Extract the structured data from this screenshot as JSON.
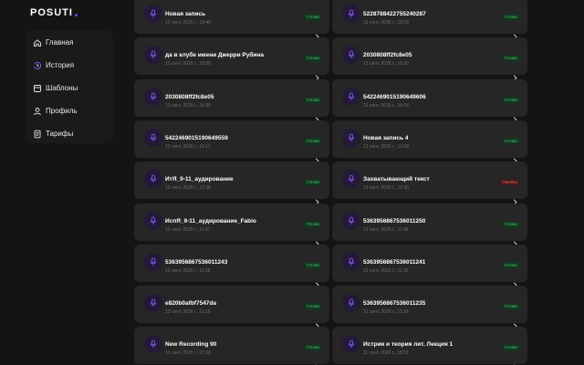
{
  "app": {
    "logo_text": "POSUTI",
    "accent_color": "#6b3bff"
  },
  "sidebar": {
    "items": [
      {
        "label": "Главная",
        "icon": "home-icon"
      },
      {
        "label": "История",
        "icon": "history-icon"
      },
      {
        "label": "Шаблоны",
        "icon": "templates-icon"
      },
      {
        "label": "Профиль",
        "icon": "profile-icon"
      },
      {
        "label": "Тарифы",
        "icon": "pricing-icon"
      }
    ]
  },
  "records": [
    {
      "title": "Новая запись",
      "date": "12 сент. 2026 г., 19:40",
      "status": "Готово",
      "status_type": "ok"
    },
    {
      "title": "5228788422755240287",
      "date": "12 сент. 2026 г., 19:18",
      "status": "Готово",
      "status_type": "ok"
    },
    {
      "title": "да в клубе имени Джерри Рубина",
      "date": "12 сент. 2026 г., 18:26",
      "status": "Готово",
      "status_type": "ok"
    },
    {
      "title": "2030808ff2fc8e05",
      "date": "12 сент. 2026 г., 16:30",
      "status": "Готово",
      "status_type": "ok"
    },
    {
      "title": "2030808ff2fc8e05",
      "date": "12 сент. 2026 г., 16:30",
      "status": "Готово",
      "status_type": "ok"
    },
    {
      "title": "5422469015190649606",
      "date": "12 сент. 2026 г., 15:04",
      "status": "Готово",
      "status_type": "ok"
    },
    {
      "title": "5422469015190649559",
      "date": "12 сент. 2026 г., 14:11",
      "status": "Готово",
      "status_type": "ok"
    },
    {
      "title": "Новая запись 4",
      "date": "12 сент. 2026 г., 13:08",
      "status": "Готово",
      "status_type": "ok"
    },
    {
      "title": "ИтЯ_9-11_аудирование",
      "date": "12 сент. 2026 г., 12:38",
      "status": "Готово",
      "status_type": "ok"
    },
    {
      "title": "Захватывающий текст",
      "date": "12 сент. 2026 г., 12:30",
      "status": "Ошибка",
      "status_type": "err"
    },
    {
      "title": "ИспЯ_9-11_аудирование_Fabio",
      "date": "12 сент. 2026 г., 11:57",
      "status": "Готово",
      "status_type": "ok"
    },
    {
      "title": "5363956867536011250",
      "date": "12 сент. 2026 г., 11:48",
      "status": "Готово",
      "status_type": "ok"
    },
    {
      "title": "5363956867536011243",
      "date": "12 сент. 2026 г., 11:28",
      "status": "Готово",
      "status_type": "ok"
    },
    {
      "title": "5363956867536011241",
      "date": "12 сент. 2026 г., 11:18",
      "status": "Готово",
      "status_type": "ok"
    },
    {
      "title": "e820b0afbf7547da",
      "date": "12 сент. 2026 г., 11:16",
      "status": "Готово",
      "status_type": "ok"
    },
    {
      "title": "5363956867536011235",
      "date": "12 сент. 2026 г., 11:16",
      "status": "Готово",
      "status_type": "ok"
    },
    {
      "title": "New Recording 90",
      "date": "12 сент. 2026 г., 07:38",
      "status": "Готово",
      "status_type": "ok"
    },
    {
      "title": "Истрия и теория лит. Лекция 1",
      "date": "11 сент. 2026 г., 18:53",
      "status": "Готово",
      "status_type": "ok"
    }
  ]
}
